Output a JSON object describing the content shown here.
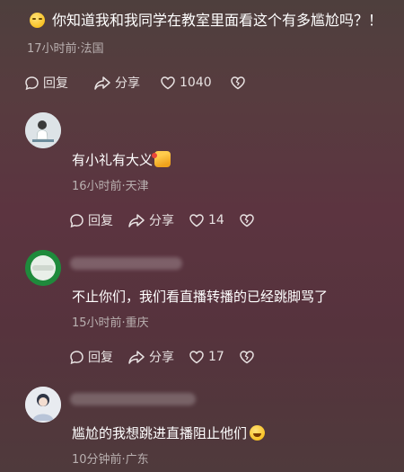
{
  "root_comment": {
    "text": "你知道我和我同学在教室里面看这个有多尴尬吗？！",
    "meta": "17小时前·法国",
    "actions": {
      "reply": "回复",
      "share": "分享",
      "likes": "1040"
    }
  },
  "replies": [
    {
      "text": "有小礼有大义",
      "meta": "16小时前·天津",
      "actions": {
        "reply": "回复",
        "share": "分享",
        "likes": "14"
      },
      "avatar_color": "#cfd6dc"
    },
    {
      "text": "不止你们，我们看直播转播的已经跳脚骂了",
      "meta": "15小时前·重庆",
      "actions": {
        "reply": "回复",
        "share": "分享",
        "likes": "17"
      },
      "avatar_color": "#1f8a3c"
    },
    {
      "text": "尴尬的我想跳进直播阻止他们",
      "meta": "10分钟前·广东"
    }
  ]
}
